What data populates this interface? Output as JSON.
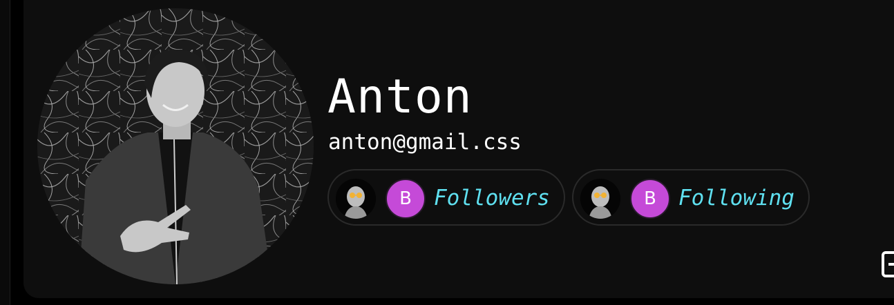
{
  "profile": {
    "name": "Anton",
    "email": "anton@gmail.css",
    "avatar_icon": "profile-photo"
  },
  "stats": {
    "followers_label": "Followers",
    "following_label": "Following",
    "avatar_letter": "B"
  },
  "icons": {
    "corner": "expand-icon"
  },
  "colors": {
    "background": "#0e0e0e",
    "accent_text": "#5fe0f0",
    "letter_avatar": "#c54ad8"
  }
}
